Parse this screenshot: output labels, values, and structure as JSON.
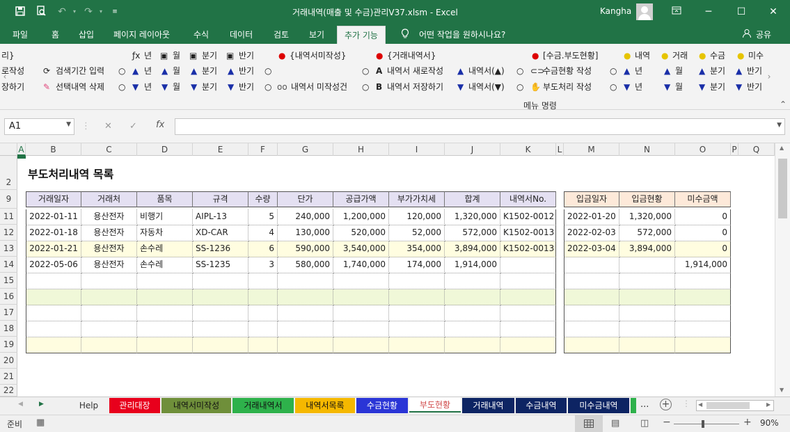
{
  "app": {
    "title": "거래내역(매출 및 수금)관리V37.xlsm  -  Excel",
    "user": "Kangha"
  },
  "ribbon_tabs": [
    "파일",
    "홈",
    "삽입",
    "페이지 레이아웃",
    "수식",
    "데이터",
    "검토",
    "보기",
    "추가 기능",
    "어떤 작업을 원하시나요?",
    "공유"
  ],
  "ribbon": {
    "left_frag": [
      "리}",
      "로작성",
      "장하기"
    ],
    "search_period": "검색기간 입력",
    "delete_selection": "선택내역 삭제",
    "h_year": "년",
    "h_month": "월",
    "h_quarter": "분기",
    "h_half": "반기",
    "g1_header": "{내역서미작성}",
    "g1_item": "내역서 미작성건",
    "g2_header": "{거래내역서}",
    "g2_new": "내역서 새로작성",
    "g2_save": "내역서 저장하기",
    "g2_up": "내역서(▲)",
    "g2_down": "내역서(▼)",
    "g3_header": "[수금.부도현황]",
    "g3_collect": "수금현황 작성",
    "g3_bounce": "부도처리 작성",
    "g4_h1": "내역",
    "g4_h2": "거래",
    "g4_h3": "수금",
    "g4_h4": "미수",
    "group_label": "메뉴 명령"
  },
  "namebox": "A1",
  "columns": [
    "A",
    "B",
    "C",
    "D",
    "E",
    "F",
    "G",
    "H",
    "I",
    "J",
    "K",
    "L",
    "M",
    "N",
    "O",
    "P",
    "Q"
  ],
  "rows": [
    "2",
    "9",
    "11",
    "12",
    "13",
    "14",
    "15",
    "16",
    "17",
    "18",
    "19",
    "20",
    "21",
    "22"
  ],
  "sheet_title": "부도처리내역 목록",
  "table1": {
    "headers": [
      "거래일자",
      "거래처",
      "품목",
      "규격",
      "수량",
      "단가",
      "공급가액",
      "부가가치세",
      "합계",
      "내역서No."
    ],
    "rows": [
      [
        "2022-01-11",
        "용산전자",
        "비행기",
        "AIPL-13",
        "5",
        "240,000",
        "1,200,000",
        "120,000",
        "1,320,000",
        "K1502-0012"
      ],
      [
        "2022-01-18",
        "용산전자",
        "자동차",
        "XD-CAR",
        "4",
        "130,000",
        "520,000",
        "52,000",
        "572,000",
        "K1502-0013"
      ],
      [
        "2022-01-21",
        "용산전자",
        "손수레",
        "SS-1236",
        "6",
        "590,000",
        "3,540,000",
        "354,000",
        "3,894,000",
        "K1502-0013"
      ],
      [
        "2022-05-06",
        "용산전자",
        "손수레",
        "SS-1235",
        "3",
        "580,000",
        "1,740,000",
        "174,000",
        "1,914,000",
        ""
      ]
    ]
  },
  "table2": {
    "headers": [
      "입금일자",
      "입금현황",
      "미수금액"
    ],
    "rows": [
      [
        "2022-01-20",
        "1,320,000",
        "0"
      ],
      [
        "2022-02-03",
        "572,000",
        "0"
      ],
      [
        "2022-03-04",
        "3,894,000",
        "0"
      ],
      [
        "",
        "",
        "1,914,000"
      ]
    ]
  },
  "sheet_tabs": [
    {
      "label": "Help",
      "bg": "#f0f0f0",
      "fg": "#333333"
    },
    {
      "label": "관리대장",
      "bg": "#e8001c",
      "fg": "#ffffff"
    },
    {
      "label": "내역서미작성",
      "bg": "#6f8f3a",
      "fg": "#111111"
    },
    {
      "label": "거래내역서",
      "bg": "#2eb14b",
      "fg": "#111111"
    },
    {
      "label": "내역서목록",
      "bg": "#f5b800",
      "fg": "#111111"
    },
    {
      "label": "수금현황",
      "bg": "#2a35d6",
      "fg": "#ffffff"
    },
    {
      "label": "부도현황",
      "bg": "#ffffff",
      "fg": "#333333"
    },
    {
      "label": "거래내역",
      "bg": "#0d2463",
      "fg": "#ffffff"
    },
    {
      "label": "수금내역",
      "bg": "#0d2463",
      "fg": "#ffffff"
    },
    {
      "label": "미수금내역",
      "bg": "#0d2463",
      "fg": "#ffffff"
    }
  ],
  "status": {
    "ready": "준비",
    "zoom": "90%"
  },
  "colors": {
    "excel_green": "#217346",
    "row_yellow": "#fffde0",
    "row_green": "#f0f8d8",
    "header_lilac": "#e4e0f2",
    "header_peach": "#fde9d9"
  }
}
